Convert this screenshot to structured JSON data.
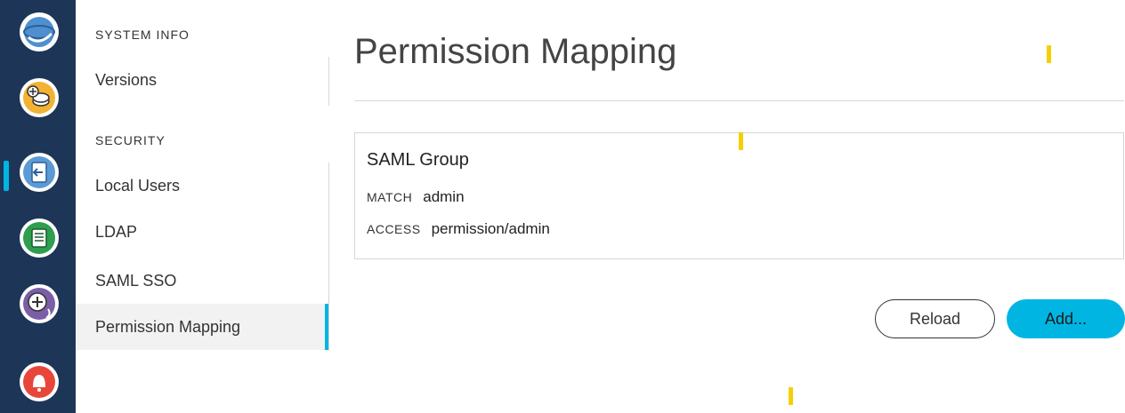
{
  "rail": {
    "items": [
      {
        "icon": "globe-icon",
        "color": "#5b9bd5"
      },
      {
        "icon": "coins-icon",
        "color": "#f2b233"
      },
      {
        "icon": "admin-logout-icon",
        "color": "#5b9bd5",
        "active": true
      },
      {
        "icon": "document-icon",
        "color": "#2e9e4f"
      },
      {
        "icon": "network-add-icon",
        "color": "#7b5ea7"
      },
      {
        "icon": "alert-bell-icon",
        "color": "#e8463a"
      }
    ]
  },
  "nav": {
    "system_info_heading": "SYSTEM INFO",
    "versions": "Versions",
    "security_heading": "SECURITY",
    "local_users": "Local Users",
    "ldap": "LDAP",
    "saml_sso": "SAML SSO",
    "permission_mapping": "Permission Mapping"
  },
  "main": {
    "title": "Permission Mapping",
    "card": {
      "title": "SAML Group",
      "match_label": "MATCH",
      "match_value": "admin",
      "access_label": "ACCESS",
      "access_value": "permission/admin"
    },
    "reload_label": "Reload",
    "add_label": "Add..."
  },
  "colors": {
    "rail_bg": "#1d3557",
    "accent": "#00b5e2",
    "marker": "#f5d000"
  }
}
